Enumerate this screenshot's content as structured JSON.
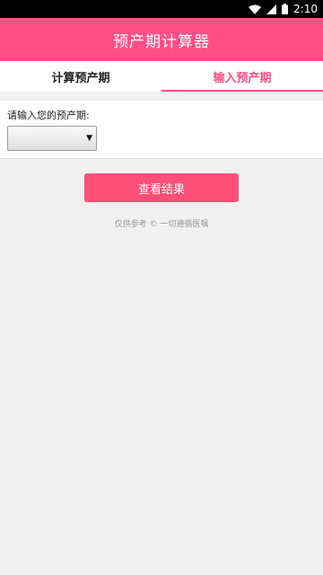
{
  "status_bar": {
    "time": "2:10",
    "icons": [
      "wifi-icon",
      "signal-icon",
      "battery-icon"
    ]
  },
  "app_bar": {
    "title": "预产期计算器"
  },
  "tabs": [
    {
      "label": "计算预产期",
      "active": false
    },
    {
      "label": "输入预产期",
      "active": true
    }
  ],
  "form": {
    "label": "请输入您的预产期:",
    "select_value": ""
  },
  "result_button": {
    "label": "查看结果"
  },
  "footnote": "仅供参考 © 一切遵循医嘱",
  "colors": {
    "primary": "#ff4f86",
    "button": "#ff4f78",
    "background": "#f1f1f1"
  }
}
